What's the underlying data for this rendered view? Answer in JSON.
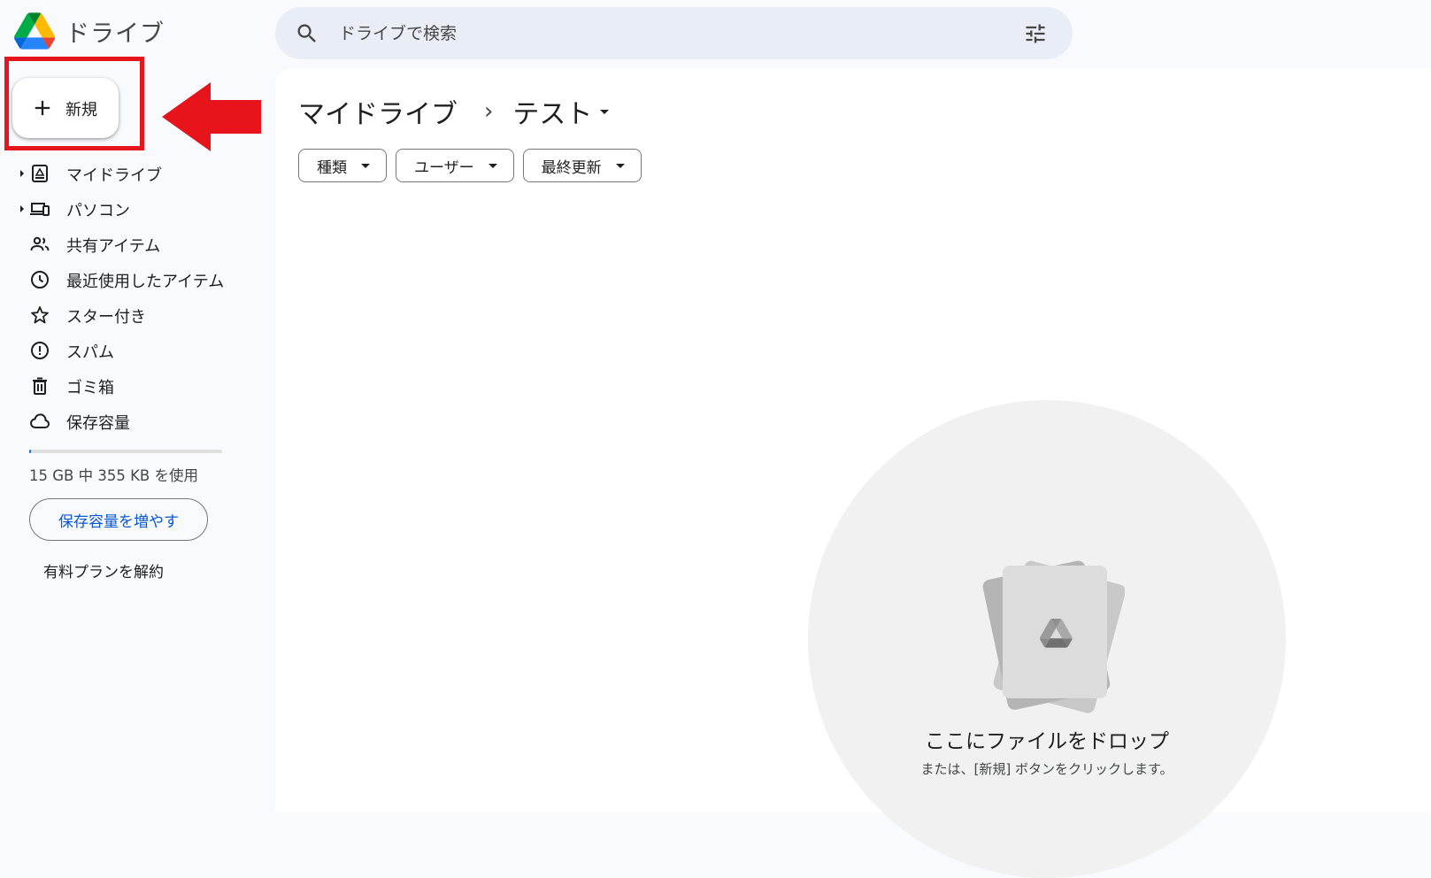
{
  "app": {
    "title": "ドライブ"
  },
  "search": {
    "placeholder": "ドライブで検索"
  },
  "new_button": {
    "label": "新規"
  },
  "sidebar": {
    "items": [
      {
        "label": "マイドライブ",
        "icon": "my-drive-icon",
        "expandable": true
      },
      {
        "label": "パソコン",
        "icon": "computer-icon",
        "expandable": true
      },
      {
        "label": "共有アイテム",
        "icon": "people-icon",
        "expandable": false
      },
      {
        "label": "最近使用したアイテム",
        "icon": "clock-icon",
        "expandable": false
      },
      {
        "label": "スター付き",
        "icon": "star-icon",
        "expandable": false
      },
      {
        "label": "スパム",
        "icon": "spam-icon",
        "expandable": false
      },
      {
        "label": "ゴミ箱",
        "icon": "trash-icon",
        "expandable": false
      },
      {
        "label": "保存容量",
        "icon": "cloud-icon",
        "expandable": false
      }
    ]
  },
  "storage": {
    "used_text": "15 GB 中 355 KB を使用",
    "used_fraction": 0.01,
    "upgrade_label": "保存容量を増やす",
    "cancel_plan_label": "有料プランを解約"
  },
  "breadcrumb": {
    "root": "マイドライブ",
    "separator": "›",
    "current": "テスト"
  },
  "filters": [
    {
      "label": "種類"
    },
    {
      "label": "ユーザー"
    },
    {
      "label": "最終更新"
    }
  ],
  "empty_state": {
    "title": "ここにファイルをドロップ",
    "subtitle": "または、[新規] ボタンをクリックします。"
  },
  "colors": {
    "accent": "#0b57d0",
    "highlight_red": "#e8141c",
    "drive_green": "#1ea362",
    "drive_yellow": "#ffba00",
    "drive_blue": "#2684fc"
  }
}
